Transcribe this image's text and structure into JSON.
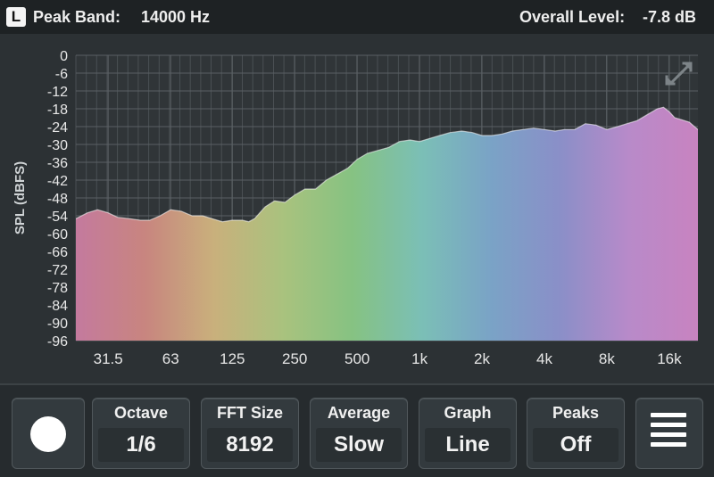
{
  "header": {
    "channel": "L",
    "peak_label": "Peak Band:",
    "peak_value": "14000 Hz",
    "level_label": "Overall Level:",
    "level_value": "-7.8 dB"
  },
  "toolbar": {
    "record_icon": "record-circle",
    "menu_icon": "hamburger-menu",
    "octave": {
      "label": "Octave",
      "value": "1/6"
    },
    "fft": {
      "label": "FFT Size",
      "value": "8192"
    },
    "average": {
      "label": "Average",
      "value": "Slow"
    },
    "graph": {
      "label": "Graph",
      "value": "Line"
    },
    "peaks": {
      "label": "Peaks",
      "value": "Off"
    }
  },
  "chart_data": {
    "type": "area",
    "ylabel": "SPL (dBFS)",
    "ylim": [
      -96,
      0
    ],
    "yticks": [
      "0",
      "-6",
      "-12",
      "-18",
      "-24",
      "-30",
      "-36",
      "-42",
      "-48",
      "-54",
      "-60",
      "-66",
      "-72",
      "-78",
      "-84",
      "-90",
      "-96"
    ],
    "x_scale": "log",
    "x_ticks": [
      {
        "label": "31.5",
        "hz": 31.5
      },
      {
        "label": "63",
        "hz": 63
      },
      {
        "label": "125",
        "hz": 125
      },
      {
        "label": "250",
        "hz": 250
      },
      {
        "label": "500",
        "hz": 500
      },
      {
        "label": "1k",
        "hz": 1000
      },
      {
        "label": "2k",
        "hz": 2000
      },
      {
        "label": "4k",
        "hz": 4000
      },
      {
        "label": "8k",
        "hz": 8000
      },
      {
        "label": "16k",
        "hz": 16000
      }
    ],
    "xlim": [
      22,
      22000
    ],
    "grid": true,
    "colors": [
      "#c47a9e",
      "#c8857f",
      "#c9b07c",
      "#a9c27e",
      "#86c282",
      "#7bbfb6",
      "#7aa3c6",
      "#8a8fc8",
      "#b88ac9",
      "#c883c0"
    ],
    "points": [
      {
        "hz": 22,
        "db": -55
      },
      {
        "hz": 25,
        "db": -53
      },
      {
        "hz": 28,
        "db": -52
      },
      {
        "hz": 31.5,
        "db": -53
      },
      {
        "hz": 35,
        "db": -54.5
      },
      {
        "hz": 40,
        "db": -55
      },
      {
        "hz": 45,
        "db": -55.5
      },
      {
        "hz": 50,
        "db": -55.5
      },
      {
        "hz": 56,
        "db": -54
      },
      {
        "hz": 63,
        "db": -52
      },
      {
        "hz": 71,
        "db": -52.5
      },
      {
        "hz": 80,
        "db": -54
      },
      {
        "hz": 90,
        "db": -54
      },
      {
        "hz": 100,
        "db": -55
      },
      {
        "hz": 112,
        "db": -56
      },
      {
        "hz": 125,
        "db": -55.5
      },
      {
        "hz": 140,
        "db": -55.5
      },
      {
        "hz": 150,
        "db": -56
      },
      {
        "hz": 160,
        "db": -55
      },
      {
        "hz": 180,
        "db": -51
      },
      {
        "hz": 200,
        "db": -49
      },
      {
        "hz": 224,
        "db": -49.5
      },
      {
        "hz": 250,
        "db": -47
      },
      {
        "hz": 280,
        "db": -45
      },
      {
        "hz": 315,
        "db": -45
      },
      {
        "hz": 355,
        "db": -42
      },
      {
        "hz": 400,
        "db": -40
      },
      {
        "hz": 450,
        "db": -38
      },
      {
        "hz": 500,
        "db": -35
      },
      {
        "hz": 560,
        "db": -33
      },
      {
        "hz": 630,
        "db": -32
      },
      {
        "hz": 710,
        "db": -31
      },
      {
        "hz": 800,
        "db": -29
      },
      {
        "hz": 900,
        "db": -28.5
      },
      {
        "hz": 1000,
        "db": -29
      },
      {
        "hz": 1120,
        "db": -28
      },
      {
        "hz": 1250,
        "db": -27
      },
      {
        "hz": 1400,
        "db": -26
      },
      {
        "hz": 1600,
        "db": -25.5
      },
      {
        "hz": 1800,
        "db": -26
      },
      {
        "hz": 2000,
        "db": -27
      },
      {
        "hz": 2240,
        "db": -27
      },
      {
        "hz": 2500,
        "db": -26.5
      },
      {
        "hz": 2800,
        "db": -25.5
      },
      {
        "hz": 3150,
        "db": -25
      },
      {
        "hz": 3550,
        "db": -24.5
      },
      {
        "hz": 4000,
        "db": -25
      },
      {
        "hz": 4500,
        "db": -25.5
      },
      {
        "hz": 5000,
        "db": -25
      },
      {
        "hz": 5600,
        "db": -25
      },
      {
        "hz": 6300,
        "db": -23
      },
      {
        "hz": 7100,
        "db": -23.5
      },
      {
        "hz": 8000,
        "db": -25
      },
      {
        "hz": 9000,
        "db": -24
      },
      {
        "hz": 10000,
        "db": -23
      },
      {
        "hz": 11200,
        "db": -22
      },
      {
        "hz": 12500,
        "db": -20
      },
      {
        "hz": 14000,
        "db": -18
      },
      {
        "hz": 15000,
        "db": -17.5
      },
      {
        "hz": 16000,
        "db": -19
      },
      {
        "hz": 17000,
        "db": -21
      },
      {
        "hz": 18000,
        "db": -21.5
      },
      {
        "hz": 20000,
        "db": -22.5
      },
      {
        "hz": 22000,
        "db": -25
      }
    ]
  }
}
